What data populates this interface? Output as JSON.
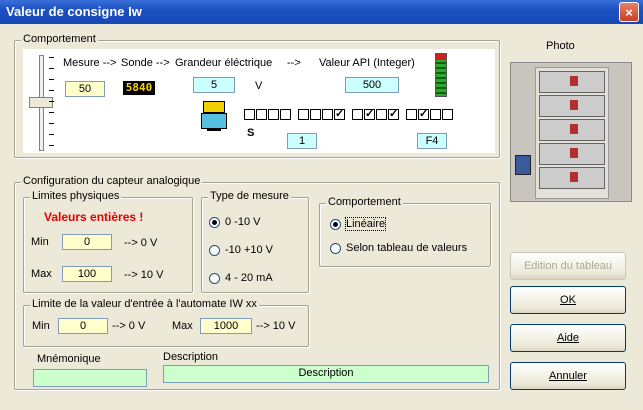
{
  "window": {
    "title": "Valeur de consigne Iw",
    "close_glyph": "×"
  },
  "comportement_top": {
    "legend": "Comportement",
    "mesure_label": "Mesure -->",
    "sonde_label": "Sonde -->",
    "grandeur_label": "Grandeur éléctrique",
    "arrow": "-->",
    "api_label": "Valeur API (Integer)",
    "mesure_value": "50",
    "sonde_display": "5840",
    "grandeur_value": "5",
    "grandeur_unit": "V",
    "api_value": "500",
    "s_label": "S",
    "bit_field": "1",
    "hex_field": "F4",
    "bits": [
      0,
      0,
      0,
      0,
      0,
      0,
      0,
      1,
      0,
      1,
      0,
      1,
      0,
      1,
      0,
      0
    ]
  },
  "photo_label": "Photo",
  "config": {
    "legend": "Configuration du capteur analogique",
    "limites": {
      "legend": "Limites physiques",
      "warning": "Valeurs entières !",
      "min_label": "Min",
      "min_value": "0",
      "min_out": "--> 0 V",
      "max_label": "Max",
      "max_value": "100",
      "max_out": "--> 10 V"
    },
    "type_mesure": {
      "legend": "Type de mesure",
      "options": [
        "0 -10 V",
        "-10  +10 V",
        "4 - 20 mA"
      ],
      "selected": 0
    },
    "comportement": {
      "legend": "Comportement",
      "options": [
        "Linéaire",
        "Selon tableau de valeurs"
      ],
      "selected": 0
    },
    "limite_entree": {
      "legend": "Limite de la valeur d'entrée à l'automate  IW xx",
      "min_label": "Min",
      "min_value": "0",
      "min_out": "--> 0 V",
      "max_label": "Max",
      "max_value": "1000",
      "max_out": "--> 10 V"
    },
    "mnemonique_label": "Mnémonique",
    "mnemonique_value": "",
    "description_label": "Description",
    "description_value": "Description"
  },
  "buttons": {
    "edition": "Edition du tableau",
    "ok": "OK",
    "aide": "Aide",
    "annuler": "Annuler"
  },
  "icons": [
    "close-icon",
    "slider-icon",
    "sensor-display-icon",
    "led-bar-icon",
    "terminal-icon",
    "photo-icon"
  ]
}
